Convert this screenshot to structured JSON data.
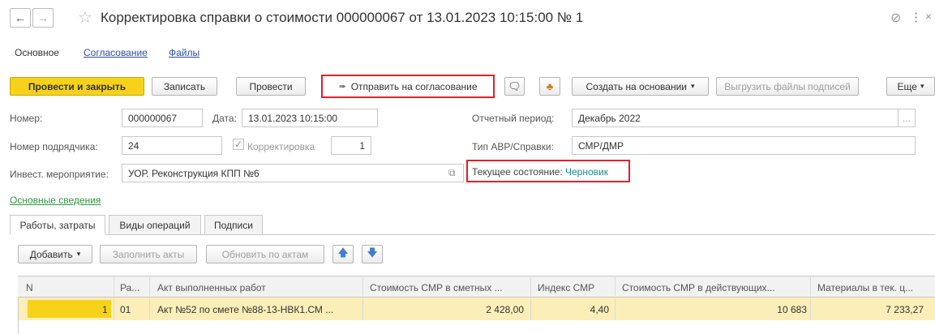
{
  "window": {
    "title": "Корректировка справки о стоимости 000000067 от 13.01.2023 10:15:00 № 1"
  },
  "tabs": [
    "Основное",
    "Согласование",
    "Файлы"
  ],
  "toolbar": {
    "post_close": "Провести и закрыть",
    "save": "Записать",
    "post": "Провести",
    "send_approval": "Отправить на согласование",
    "create_based": "Создать на основании",
    "export_signatures": "Выгрузить файлы подписей",
    "more": "Еще"
  },
  "form": {
    "number_label": "Номер:",
    "number_value": "000000067",
    "date_label": "Дата:",
    "date_value": "13.01.2023 10:15:00",
    "period_label": "Отчетный период:",
    "period_value": "Декабрь 2022",
    "contractor_label": "Номер подрядчика:",
    "contractor_value": "24",
    "correction_label": "Корректировка",
    "correction_value": "1",
    "type_label": "Тип АВР/Справки:",
    "type_value": "СМР/ДМР",
    "invest_label": "Инвест. мероприятие:",
    "invest_value": "УОР. Реконструкция КПП №6",
    "state_label": "Текущее состояние:",
    "state_value": "Черновик",
    "main_info_link": "Основные сведения"
  },
  "inner_tabs": [
    "Работы, затраты",
    "Виды операций",
    "Подписи"
  ],
  "grid_toolbar": {
    "add": "Добавить",
    "fill_acts": "Заполнить акты",
    "update_acts": "Обновить по актам"
  },
  "table": {
    "headers": [
      "N",
      "Ра...",
      "Акт выполненных работ",
      "Стоимость СМР в сметных ...",
      "Индекс СМР",
      "Стоимость СМР в действующих...",
      "Материалы в тек. ц..."
    ],
    "rows": [
      [
        "1",
        "01",
        "Акт №52 по смете №88-13-НВК1.СМ ...",
        "2 428,00",
        "4,40",
        "10 683",
        "7 233,27"
      ]
    ]
  },
  "colors": {
    "accent_yellow": "#f6d21a",
    "highlight_red": "#e1202b",
    "link_blue": "#2d4ea1",
    "state_teal": "#1a8c8c",
    "row_yellow": "#fbeeb8"
  }
}
